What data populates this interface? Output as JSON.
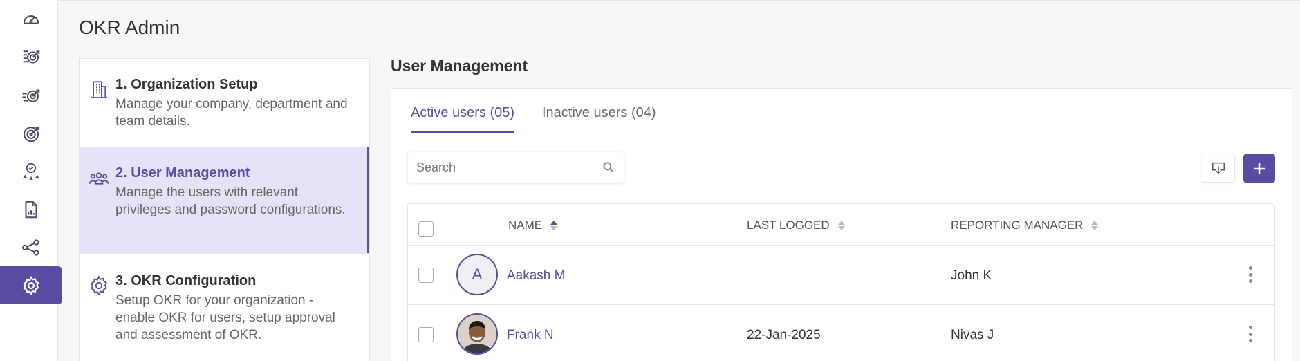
{
  "app": {
    "title": "OKR Admin"
  },
  "rail": {
    "items": [
      {
        "icon": "dashboard-icon"
      },
      {
        "icon": "checklist-target-icon"
      },
      {
        "icon": "fast-target-icon"
      },
      {
        "icon": "target-icon"
      },
      {
        "icon": "award-stars-icon"
      },
      {
        "icon": "report-icon"
      },
      {
        "icon": "network-icon"
      },
      {
        "icon": "gear-icon",
        "active": true
      }
    ]
  },
  "steps": [
    {
      "icon": "building-icon",
      "title": "1. Organization Setup",
      "desc": "Manage your company, department and team details."
    },
    {
      "icon": "users-group-icon",
      "title": "2. User Management",
      "desc": "Manage the users with relevant privileges and password configurations.",
      "active": true
    },
    {
      "icon": "gear-outline-icon",
      "title": "3. OKR Configuration",
      "desc": "Setup OKR for your organization - enable OKR for users, setup approval and assessment of OKR."
    }
  ],
  "section": {
    "title": "User Management"
  },
  "tabs": [
    {
      "label": "Active users (05)",
      "active": true
    },
    {
      "label": "Inactive users (04)",
      "active": false
    }
  ],
  "search": {
    "placeholder": "Search",
    "value": ""
  },
  "table": {
    "columns": [
      {
        "label": "NAME",
        "sort": "asc"
      },
      {
        "label": "LAST LOGGED",
        "sort": "none"
      },
      {
        "label": "REPORTING MANAGER",
        "sort": "none"
      }
    ],
    "rows": [
      {
        "avatar_initial": "A",
        "name": "Aakash M",
        "last_logged": "",
        "manager": "John K"
      },
      {
        "avatar_initial": "",
        "avatar_photo": true,
        "name": "Frank N",
        "last_logged": "22-Jan-2025",
        "manager": "Nivas J"
      }
    ]
  },
  "colors": {
    "accent": "#5a4ba3",
    "accent_light": "#e5e3f8"
  }
}
